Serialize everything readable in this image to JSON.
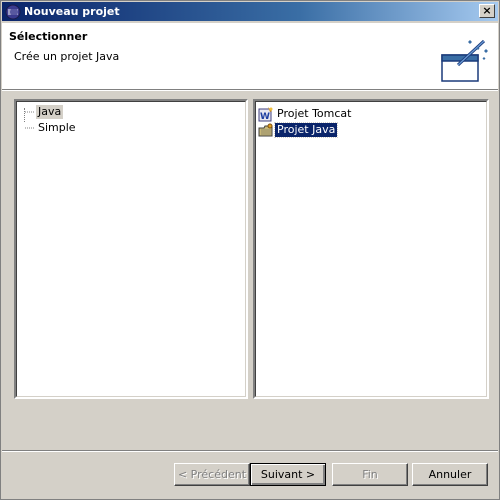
{
  "window": {
    "title": "Nouveau projet",
    "close_label": "×"
  },
  "header": {
    "title": "Sélectionner",
    "description": "Crée un projet Java"
  },
  "tree": {
    "items": [
      {
        "label": "Java",
        "selected": true
      },
      {
        "label": "Simple",
        "selected": false
      }
    ]
  },
  "list": {
    "items": [
      {
        "label": "Projet Tomcat",
        "icon": "tomcat-icon",
        "selected": false
      },
      {
        "label": "Projet Java",
        "icon": "java-project-icon",
        "selected": true
      }
    ]
  },
  "buttons": {
    "previous": "< Précédent",
    "next": "Suivant >",
    "finish": "Fin",
    "cancel": "Annuler"
  },
  "colors": {
    "titlebar_start": "#0a246a",
    "titlebar_end": "#a6caf0",
    "selection": "#0a246a",
    "dialog_bg": "#d4d0c8"
  }
}
